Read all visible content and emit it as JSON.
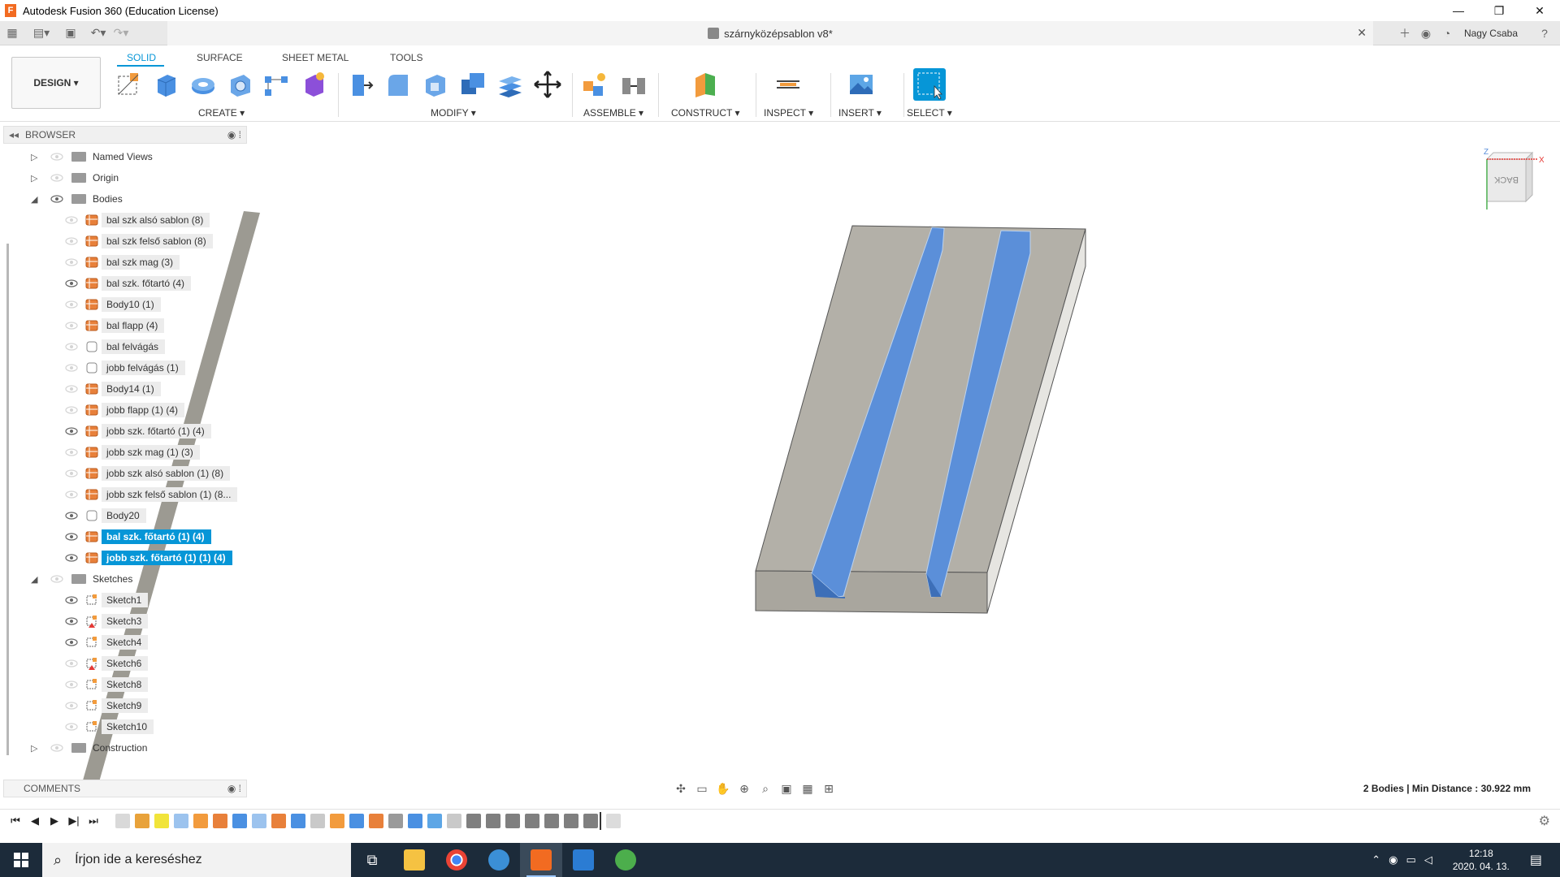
{
  "window": {
    "title": "Autodesk Fusion 360 (Education License)",
    "minimize": "—",
    "restore": "❐",
    "close": "✕"
  },
  "tabbar": {
    "document_title": "szárnyközépsablon v8*",
    "close_glyph": "✕",
    "user": "Nagy Csaba"
  },
  "ribbon": {
    "workspace": "DESIGN ▾",
    "tabs": [
      "SOLID",
      "SURFACE",
      "SHEET METAL",
      "TOOLS"
    ],
    "groups": [
      "CREATE ▾",
      "MODIFY ▾",
      "ASSEMBLE ▾",
      "CONSTRUCT ▾",
      "INSPECT ▾",
      "INSERT ▾",
      "SELECT ▾"
    ]
  },
  "browser": {
    "header": "BROWSER",
    "items": [
      {
        "label": "Named Views",
        "kind": "folder",
        "level": 0,
        "expand": "▷"
      },
      {
        "label": "Origin",
        "kind": "folder",
        "level": 0,
        "expand": "▷"
      },
      {
        "label": "Bodies",
        "kind": "folder",
        "level": 0,
        "expand": "◢"
      },
      {
        "label": "bal szk alsó sablon (8)",
        "kind": "body",
        "level": 1
      },
      {
        "label": "bal szk felső sablon (8)",
        "kind": "body",
        "level": 1
      },
      {
        "label": "bal szk mag (3)",
        "kind": "body",
        "level": 1
      },
      {
        "label": "bal szk. főtartó (4)",
        "kind": "body",
        "level": 1
      },
      {
        "label": "Body10 (1)",
        "kind": "body",
        "level": 1
      },
      {
        "label": "bal flapp (4)",
        "kind": "body",
        "level": 1
      },
      {
        "label": "bal felvágás",
        "kind": "body-blank",
        "level": 1
      },
      {
        "label": "jobb  felvágás  (1)",
        "kind": "body-blank",
        "level": 1
      },
      {
        "label": "Body14 (1)",
        "kind": "body",
        "level": 1
      },
      {
        "label": "jobb flapp (1) (4)",
        "kind": "body",
        "level": 1
      },
      {
        "label": "jobb szk. főtartó (1) (4)",
        "kind": "body",
        "level": 1
      },
      {
        "label": "jobb szk mag (1) (3)",
        "kind": "body",
        "level": 1
      },
      {
        "label": "jobb szk alsó sablon (1) (8)",
        "kind": "body",
        "level": 1
      },
      {
        "label": "jobb szk felső sablon (1) (8...",
        "kind": "body",
        "level": 1
      },
      {
        "label": "Body20",
        "kind": "body-blank",
        "level": 1
      },
      {
        "label": "bal szk. főtartó (1) (4)",
        "kind": "body",
        "level": 1,
        "selected": true
      },
      {
        "label": "jobb szk. főtartó (1) (1) (4)",
        "kind": "body",
        "level": 1,
        "selected": true
      },
      {
        "label": "Sketches",
        "kind": "folder",
        "level": 0,
        "expand": "◢"
      },
      {
        "label": "Sketch1",
        "kind": "sketch",
        "level": 1
      },
      {
        "label": "Sketch3",
        "kind": "sketch-warn",
        "level": 1
      },
      {
        "label": "Sketch4",
        "kind": "sketch",
        "level": 1
      },
      {
        "label": "Sketch6",
        "kind": "sketch-warn",
        "level": 1
      },
      {
        "label": "Sketch8",
        "kind": "sketch",
        "level": 1
      },
      {
        "label": "Sketch9",
        "kind": "sketch",
        "level": 1
      },
      {
        "label": "Sketch10",
        "kind": "sketch",
        "level": 1
      },
      {
        "label": "Construction",
        "kind": "folder",
        "level": 0,
        "expand": "▷"
      }
    ]
  },
  "comments": {
    "label": "COMMENTS"
  },
  "viewcube": {
    "face": "BACK",
    "axis_x": "X",
    "axis_z": "Z"
  },
  "status": {
    "text": "2 Bodies | Min Distance : 30.922 mm"
  },
  "taskbar": {
    "search_placeholder": "Írjon ide a kereséshez",
    "time": "12:18",
    "date": "2020. 04. 13."
  },
  "colors": {
    "accent": "#0696d7",
    "body_top": "#b3b0a8",
    "body_side": "#9c9990",
    "slot": "#5b8fd9",
    "taskbar": "#1c2b3a"
  }
}
